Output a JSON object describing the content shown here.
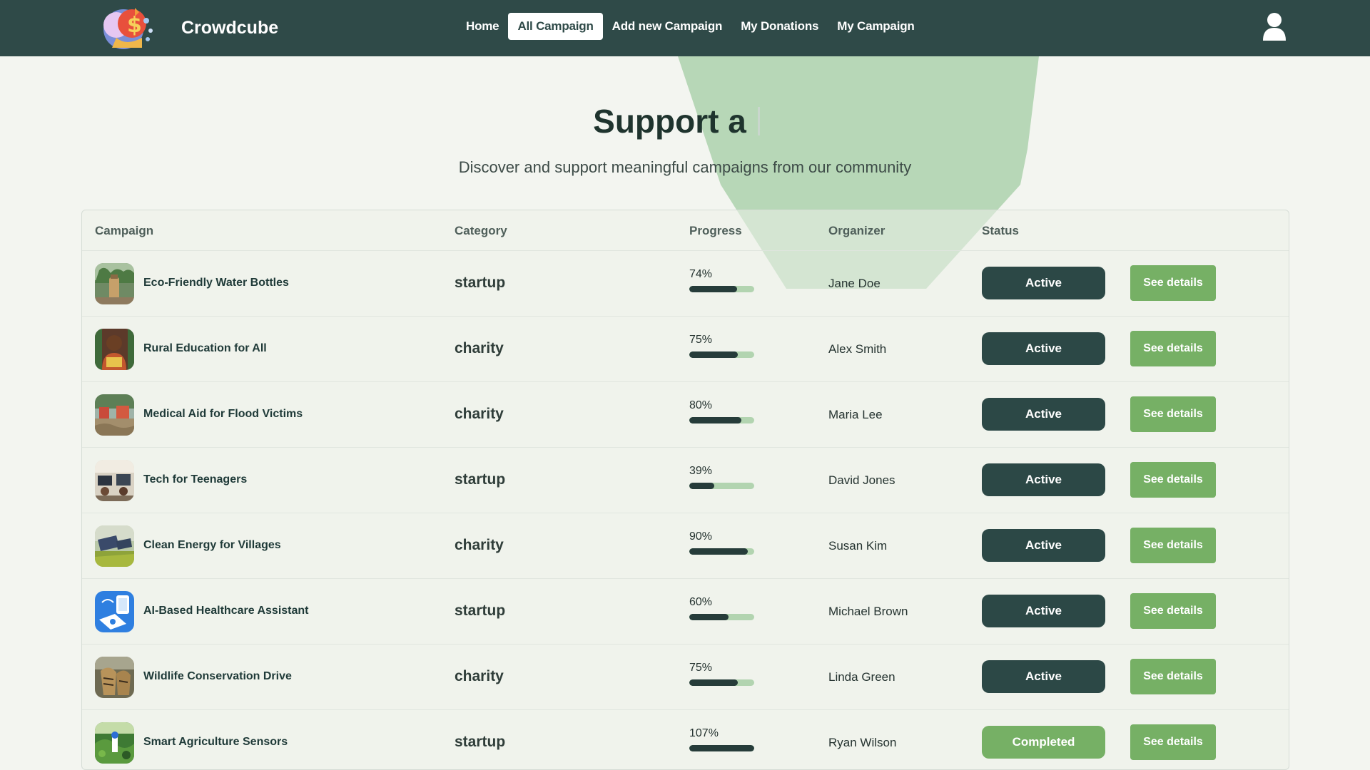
{
  "nav": {
    "brand": "Crowdcube",
    "links": [
      {
        "label": "Home",
        "active": false
      },
      {
        "label": "All Campaign",
        "active": true
      },
      {
        "label": "Add new Campaign",
        "active": false
      },
      {
        "label": "My Donations",
        "active": false
      },
      {
        "label": "My Campaign",
        "active": false
      }
    ],
    "user_icon": "user-icon"
  },
  "hero": {
    "title": "Support a",
    "subtitle": "Discover and support meaningful campaigns from our community"
  },
  "table": {
    "headers": {
      "campaign": "Campaign",
      "category": "Category",
      "progress": "Progress",
      "organizer": "Organizer",
      "status": "Status"
    },
    "details_label": "See details",
    "rows": [
      {
        "name": "Eco-Friendly Water Bottles",
        "category": "startup",
        "progress_label": "74%",
        "progress": 74,
        "organizer": "Jane Doe",
        "status": "Active"
      },
      {
        "name": "Rural Education for All",
        "category": "charity",
        "progress_label": "75%",
        "progress": 75,
        "organizer": "Alex Smith",
        "status": "Active"
      },
      {
        "name": "Medical Aid for Flood Victims",
        "category": "charity",
        "progress_label": "80%",
        "progress": 80,
        "organizer": "Maria Lee",
        "status": "Active"
      },
      {
        "name": "Tech for Teenagers",
        "category": "startup",
        "progress_label": "39%",
        "progress": 39,
        "organizer": "David Jones",
        "status": "Active"
      },
      {
        "name": "Clean Energy for Villages",
        "category": "charity",
        "progress_label": "90%",
        "progress": 90,
        "organizer": "Susan Kim",
        "status": "Active"
      },
      {
        "name": "AI-Based Healthcare Assistant",
        "category": "startup",
        "progress_label": "60%",
        "progress": 60,
        "organizer": "Michael Brown",
        "status": "Active"
      },
      {
        "name": "Wildlife Conservation Drive",
        "category": "charity",
        "progress_label": "75%",
        "progress": 75,
        "organizer": "Linda Green",
        "status": "Active"
      },
      {
        "name": "Smart Agriculture Sensors",
        "category": "startup",
        "progress_label": "107%",
        "progress": 107,
        "organizer": "Ryan Wilson",
        "status": "Completed"
      }
    ]
  },
  "colors": {
    "nav_bg": "#2f4a48",
    "active_status": "#2c4846",
    "completed_status": "#76b065",
    "details_button": "#76b065",
    "progress_track": "#b2d4b0",
    "progress_fill": "#263c3a"
  }
}
